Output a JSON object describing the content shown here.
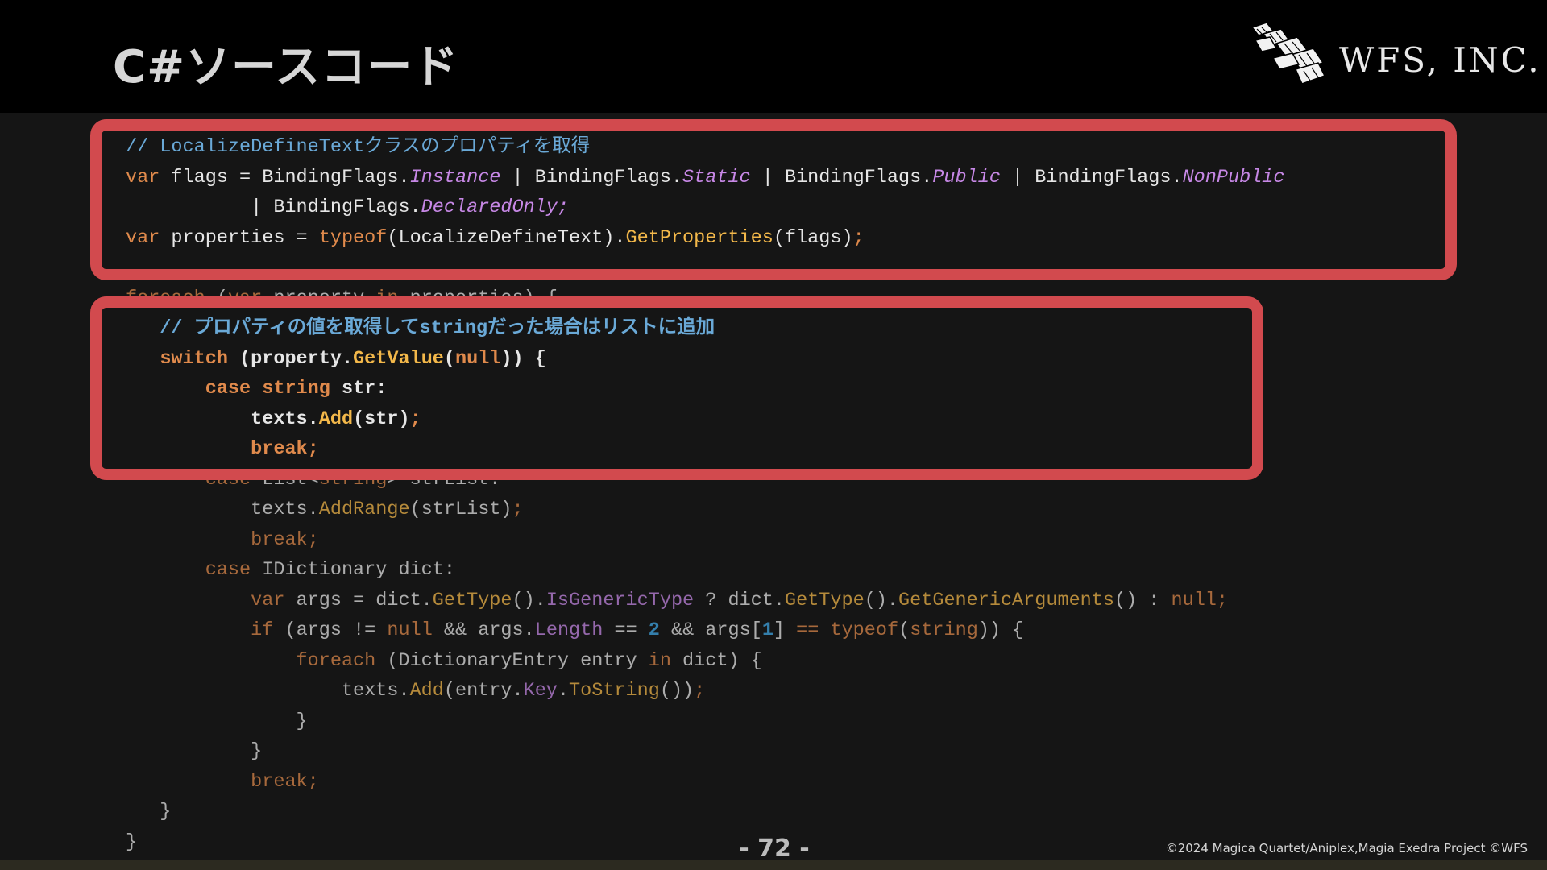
{
  "slide": {
    "title": "C#ソースコード",
    "logo_text": "WFS, INC.",
    "page_number": "- 72 -",
    "copyright": "©2024 Magica Quartet/Aniplex,Magia Exedra Project ©WFS"
  },
  "code_lines": [
    [
      {
        "t": "// LocalizeDefineTextクラスのプロパティを取得",
        "c": "c"
      }
    ],
    [
      {
        "t": "var",
        "c": "k"
      },
      {
        "t": " flags = BindingFlags."
      },
      {
        "t": "Instance",
        "c": "p"
      },
      {
        "t": " | BindingFlags."
      },
      {
        "t": "Static",
        "c": "p"
      },
      {
        "t": " | BindingFlags."
      },
      {
        "t": "Public",
        "c": "p"
      },
      {
        "t": " | BindingFlags."
      },
      {
        "t": "NonPublic",
        "c": "p"
      }
    ],
    [
      {
        "t": "           | BindingFlags."
      },
      {
        "t": "DeclaredOnly",
        "c": "p"
      },
      {
        "t": ";",
        "c": "p"
      }
    ],
    [
      {
        "t": "var",
        "c": "k"
      },
      {
        "t": " properties = "
      },
      {
        "t": "typeof",
        "c": "k"
      },
      {
        "t": "(LocalizeDefineText)."
      },
      {
        "t": "GetProperties",
        "c": "m"
      },
      {
        "t": "(flags)"
      },
      {
        "t": ";",
        "c": "k"
      }
    ],
    [
      {
        "t": ""
      }
    ],
    [
      {
        "t": "foreach",
        "c": "k"
      },
      {
        "t": " ("
      },
      {
        "t": "var",
        "c": "k"
      },
      {
        "t": " property "
      },
      {
        "t": "in",
        "c": "k"
      },
      {
        "t": " properties) {"
      }
    ],
    [
      {
        "t": "   // プロパティの値を取得してstringだった場合はリストに追加",
        "c": "c"
      }
    ],
    [
      {
        "t": "   "
      },
      {
        "t": "switch",
        "c": "k"
      },
      {
        "t": " (property."
      },
      {
        "t": "GetValue",
        "c": "m"
      },
      {
        "t": "("
      },
      {
        "t": "null",
        "c": "k"
      },
      {
        "t": ")) {"
      }
    ],
    [
      {
        "t": "       "
      },
      {
        "t": "case",
        "c": "k"
      },
      {
        "t": " "
      },
      {
        "t": "string",
        "c": "k"
      },
      {
        "t": " str:"
      }
    ],
    [
      {
        "t": "           texts."
      },
      {
        "t": "Add",
        "c": "m"
      },
      {
        "t": "(str)"
      },
      {
        "t": ";",
        "c": "k"
      }
    ],
    [
      {
        "t": "           "
      },
      {
        "t": "break",
        "c": "k"
      },
      {
        "t": ";",
        "c": "k"
      }
    ],
    [
      {
        "t": "       "
      },
      {
        "t": "case",
        "c": "k"
      },
      {
        "t": " List<"
      },
      {
        "t": "string",
        "c": "k"
      },
      {
        "t": "> strList:"
      }
    ],
    [
      {
        "t": "           texts."
      },
      {
        "t": "AddRange",
        "c": "m"
      },
      {
        "t": "(strList)"
      },
      {
        "t": ";",
        "c": "k"
      }
    ],
    [
      {
        "t": "           "
      },
      {
        "t": "break",
        "c": "k"
      },
      {
        "t": ";",
        "c": "k"
      }
    ],
    [
      {
        "t": "       "
      },
      {
        "t": "case",
        "c": "k"
      },
      {
        "t": " IDictionary dict:"
      }
    ],
    [
      {
        "t": "           "
      },
      {
        "t": "var",
        "c": "k"
      },
      {
        "t": " args = dict."
      },
      {
        "t": "GetType",
        "c": "m"
      },
      {
        "t": "()."
      },
      {
        "t": "IsGenericType",
        "c": "pn"
      },
      {
        "t": " ? dict."
      },
      {
        "t": "GetType",
        "c": "m"
      },
      {
        "t": "()."
      },
      {
        "t": "GetGenericArguments",
        "c": "m"
      },
      {
        "t": "() : "
      },
      {
        "t": "null",
        "c": "k"
      },
      {
        "t": ";",
        "c": "k"
      }
    ],
    [
      {
        "t": "           "
      },
      {
        "t": "if",
        "c": "k"
      },
      {
        "t": " (args != "
      },
      {
        "t": "null",
        "c": "k"
      },
      {
        "t": " && args."
      },
      {
        "t": "Length",
        "c": "pn"
      },
      {
        "t": " == "
      },
      {
        "t": "2",
        "c": "n"
      },
      {
        "t": " && args["
      },
      {
        "t": "1",
        "c": "n"
      },
      {
        "t": "] "
      },
      {
        "t": "==",
        "c": "k"
      },
      {
        "t": " "
      },
      {
        "t": "typeof",
        "c": "k"
      },
      {
        "t": "("
      },
      {
        "t": "string",
        "c": "k"
      },
      {
        "t": ")) {"
      }
    ],
    [
      {
        "t": "               "
      },
      {
        "t": "foreach",
        "c": "k"
      },
      {
        "t": " (DictionaryEntry entry "
      },
      {
        "t": "in",
        "c": "k"
      },
      {
        "t": " dict) {"
      }
    ],
    [
      {
        "t": "                   texts."
      },
      {
        "t": "Add",
        "c": "m"
      },
      {
        "t": "(entry."
      },
      {
        "t": "Key",
        "c": "pn"
      },
      {
        "t": "."
      },
      {
        "t": "ToString",
        "c": "m"
      },
      {
        "t": "())"
      },
      {
        "t": ";",
        "c": "k"
      }
    ],
    [
      {
        "t": "               }"
      }
    ],
    [
      {
        "t": "           }"
      }
    ],
    [
      {
        "t": "           "
      },
      {
        "t": "break",
        "c": "k"
      },
      {
        "t": ";",
        "c": "k"
      }
    ],
    [
      {
        "t": "   }"
      }
    ],
    [
      {
        "t": "}"
      }
    ]
  ],
  "highlighted_lines": [
    0,
    1,
    2,
    3,
    6,
    7,
    8,
    9,
    10
  ],
  "bold_lines": [
    6,
    7,
    8,
    9,
    10
  ],
  "colors": {
    "highlight_border": "#d24a4e",
    "comment": "#6aa9d7",
    "keyword": "#e08a4c",
    "method": "#f3b84a",
    "property": "#c788e6",
    "number": "#40a8e6"
  }
}
